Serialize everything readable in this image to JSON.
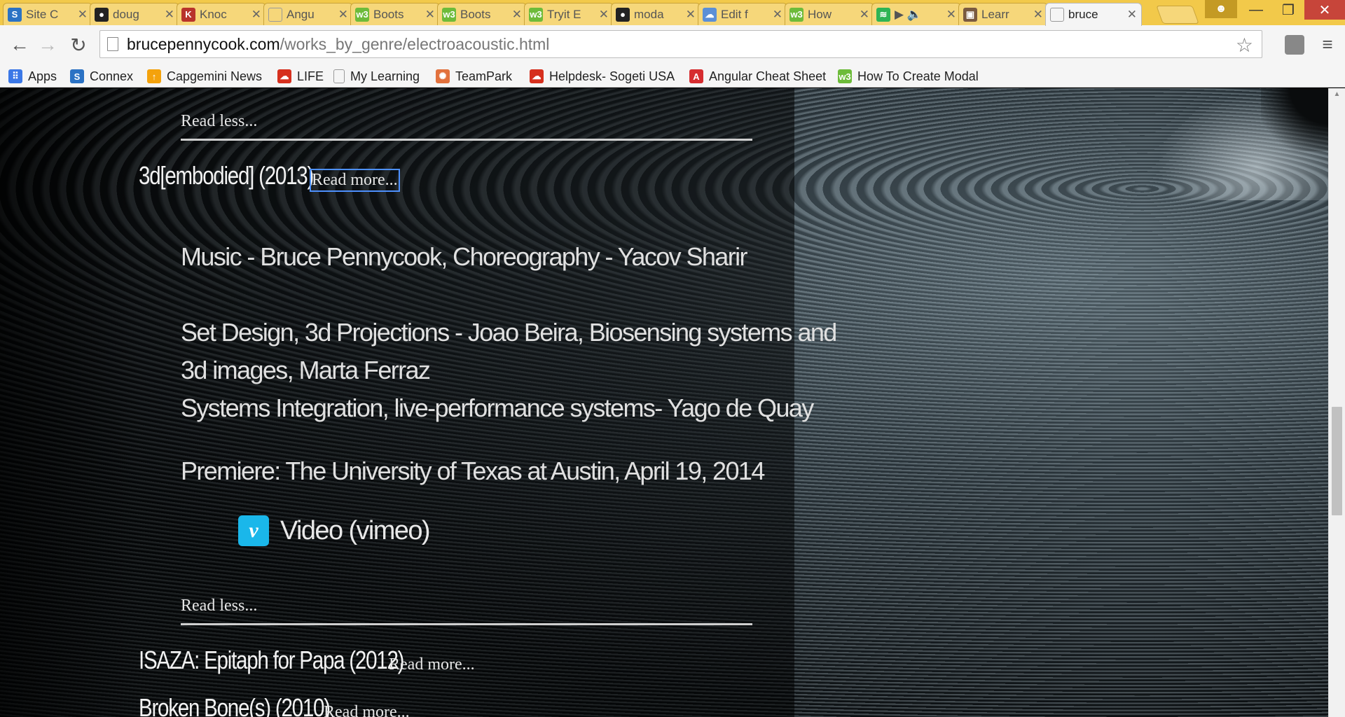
{
  "browser": {
    "tabs": [
      {
        "label": "Site C",
        "icon": "sharepoint-icon",
        "color": "#2b72c4",
        "glyph": "S"
      },
      {
        "label": "doug",
        "icon": "github-icon",
        "color": "#222222",
        "glyph": "●"
      },
      {
        "label": "Knoc",
        "icon": "knockout-icon",
        "color": "#b8332b",
        "glyph": "K"
      },
      {
        "label": "Angu",
        "icon": "page-icon",
        "color": "#9a9a9a",
        "glyph": ""
      },
      {
        "label": "Boots",
        "icon": "w3schools-icon",
        "color": "#6dbb3a",
        "glyph": "w3"
      },
      {
        "label": "Boots",
        "icon": "w3schools-icon",
        "color": "#6dbb3a",
        "glyph": "w3"
      },
      {
        "label": "Tryit E",
        "icon": "w3schools-icon",
        "color": "#6dbb3a",
        "glyph": "w3"
      },
      {
        "label": "moda",
        "icon": "github-icon",
        "color": "#222222",
        "glyph": "●"
      },
      {
        "label": "Edit f",
        "icon": "cloud-icon",
        "color": "#5b8fd6",
        "glyph": "☁"
      },
      {
        "label": "How",
        "icon": "w3schools-icon",
        "color": "#6dbb3a",
        "glyph": "w3"
      },
      {
        "label": "▶ 🔈",
        "icon": "spotify-icon",
        "color": "#2fb455",
        "glyph": "≋"
      },
      {
        "label": "Learr",
        "icon": "photo-icon",
        "color": "#7a5a40",
        "glyph": "▣"
      },
      {
        "label": "bruce",
        "icon": "page-icon",
        "color": "#9a9a9a",
        "glyph": "",
        "active": true
      }
    ],
    "tab_close_glyph": "✕",
    "window_controls": {
      "minimize": "—",
      "maximize": "❐",
      "close": "✕"
    },
    "nav": {
      "back": "←",
      "forward": "→",
      "reload": "↻"
    },
    "url_host": "brucepennycook.com",
    "url_path": "/works_by_genre/electroacoustic.html",
    "star_glyph": "☆",
    "menu_glyph": "≡",
    "bookmarks": [
      {
        "label": "Apps",
        "icon": "apps-grid-icon",
        "color": "#3b78e7",
        "glyph": "⠿"
      },
      {
        "label": "Connex",
        "icon": "sharepoint-icon",
        "color": "#2b72c4",
        "glyph": "S"
      },
      {
        "label": "Capgemini News",
        "icon": "capgemini-icon",
        "color": "#f4a20c",
        "glyph": "↑"
      },
      {
        "label": "LIFE",
        "icon": "life-icon",
        "color": "#d6301e",
        "glyph": "☁"
      },
      {
        "label": "My Learning",
        "icon": "page-icon",
        "color": "#9a9a9a",
        "glyph": ""
      },
      {
        "label": "TeamPark",
        "icon": "teampark-icon",
        "color": "#e2713d",
        "glyph": "✺"
      },
      {
        "label": "Helpdesk- Sogeti USA",
        "icon": "helpdesk-icon",
        "color": "#d6301e",
        "glyph": "☁"
      },
      {
        "label": "Angular Cheat Sheet",
        "icon": "angular-icon",
        "color": "#d62d30",
        "glyph": "A"
      },
      {
        "label": "How To Create Modal",
        "icon": "w3schools-icon",
        "color": "#6dbb3a",
        "glyph": "w3"
      }
    ]
  },
  "page": {
    "read_less_1": "Read less...",
    "work1": {
      "title": "3d[embodied] (2013)",
      "read_more": "Read more...",
      "credits": [
        "Music - Bruce Pennycook, Choreography - Yacov Sharir",
        "Set Design, 3d Projections - Joao Beira, Biosensing systems and",
        "3d images, Marta Ferraz",
        "Systems Integration, live-performance systems- Yago de Quay",
        "Premiere: The University of Texas at Austin, April 19, 2014"
      ],
      "video_icon": "vimeo-icon",
      "video_icon_glyph": "v",
      "video_label": "Video (vimeo)",
      "read_less": "Read less..."
    },
    "work2": {
      "title": "ISAZA: Epitaph for Papa (2012)",
      "read_more": "Read more..."
    },
    "work3": {
      "title": "Broken Bone(s) (2010)",
      "read_more": "Read more..."
    }
  }
}
